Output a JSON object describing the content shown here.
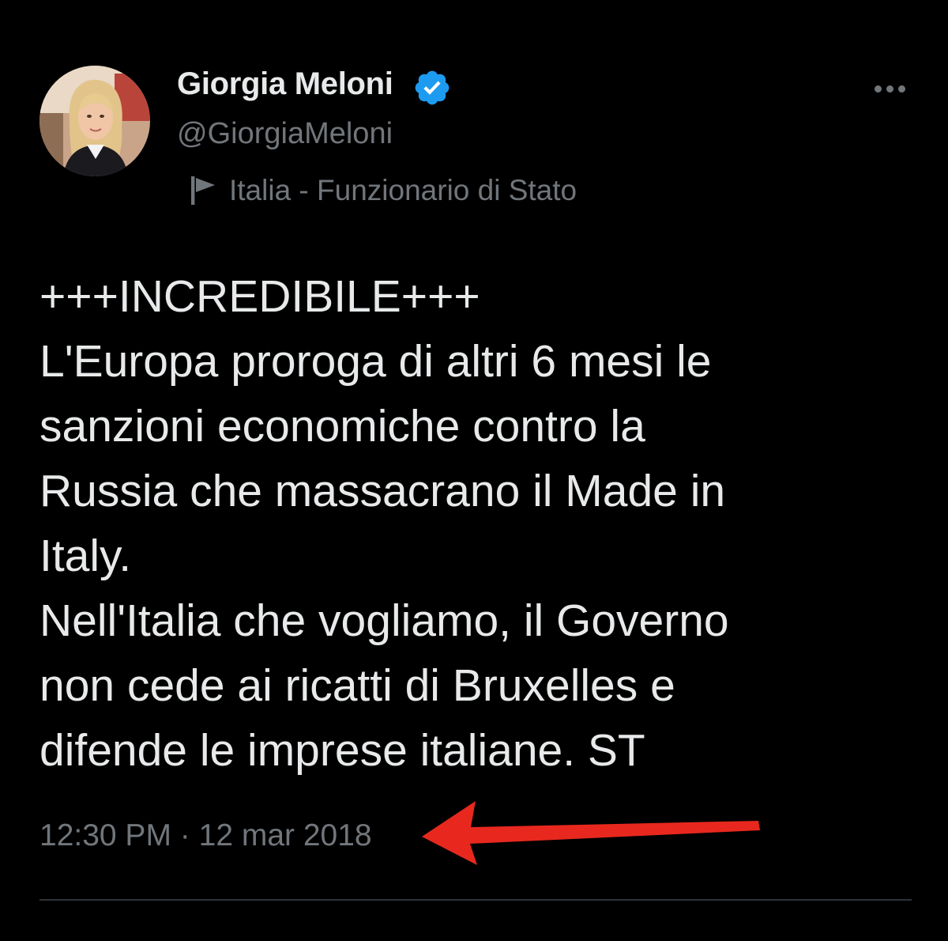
{
  "tweet": {
    "author": {
      "name": "Giorgia Meloni",
      "handle": "@GiorgiaMeloni",
      "verified": true,
      "label": "Italia - Funzionario di Stato"
    },
    "text_lines": [
      "+++INCREDIBILE+++",
      "L'Europa proroga di altri 6 mesi le",
      "sanzioni economiche contro la",
      "Russia che massacrano il Made in",
      "Italy.",
      "Nell'Italia che vogliamo, il Governo",
      "non cede ai ricatti di Bruxelles e",
      "difende le imprese italiane. ST"
    ],
    "time": "12:30 PM",
    "separator": "·",
    "date": "12 mar 2018"
  },
  "icons": {
    "verified": "verified-badge-icon",
    "more": "more-options-icon",
    "flag": "flag-icon",
    "arrow": "red-arrow-annotation"
  },
  "colors": {
    "background": "#000000",
    "text": "#e7e9ea",
    "secondary_text": "#71767b",
    "verified_blue": "#1d9bf0",
    "arrow_red": "#e8281e",
    "divider": "#2f3336"
  }
}
